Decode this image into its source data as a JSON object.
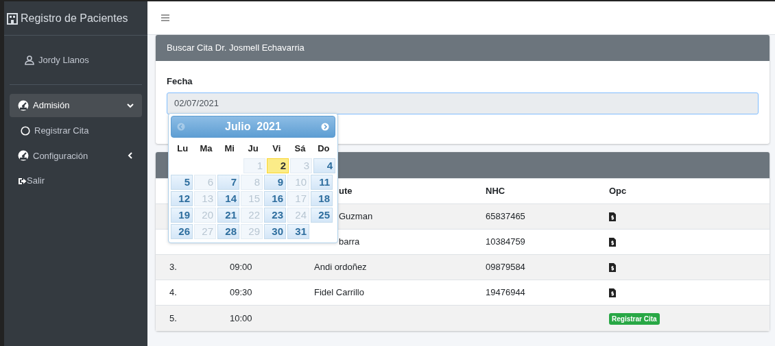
{
  "sidebar": {
    "brand": "Registro de Pacientes",
    "user": "Jordy Llanos",
    "menu": [
      {
        "kind": "group",
        "label": "Admisión",
        "selected": true,
        "expanded": true,
        "children": [
          {
            "label": "Registrar Cita",
            "selected": false
          }
        ]
      },
      {
        "kind": "group",
        "label": "Configuración",
        "selected": false,
        "expanded": false
      },
      {
        "kind": "link",
        "label": "Salir",
        "selected": false
      }
    ]
  },
  "search_card": {
    "title": "Buscar Cita Dr. Josmell Echavarria",
    "field_label": "Fecha",
    "value": "02/07/2021"
  },
  "datepicker": {
    "title": "Julio  2021",
    "prev_disabled": true,
    "weekdays": [
      "Lu",
      "Ma",
      "Mi",
      "Ju",
      "Vi",
      "Sá",
      "Do"
    ],
    "weeks": [
      {
        "days": [
          {
            "day": "1",
            "disabled": true,
            "selected": false
          },
          {
            "day": "2",
            "disabled": false,
            "selected": true
          },
          {
            "day": "3",
            "disabled": true,
            "selected": false
          },
          {
            "day": "4",
            "disabled": false,
            "selected": false
          }
        ]
      },
      {
        "days": [
          {
            "day": "5",
            "disabled": false,
            "selected": false
          },
          {
            "day": "6",
            "disabled": true,
            "selected": false
          },
          {
            "day": "7",
            "disabled": false,
            "selected": false
          },
          {
            "day": "8",
            "disabled": true,
            "selected": false
          },
          {
            "day": "9",
            "disabled": false,
            "selected": false
          },
          {
            "day": "10",
            "disabled": true,
            "selected": false
          },
          {
            "day": "11",
            "disabled": false,
            "selected": false
          }
        ]
      },
      {
        "days": [
          {
            "day": "12",
            "disabled": false,
            "selected": false
          },
          {
            "day": "13",
            "disabled": true,
            "selected": false
          },
          {
            "day": "14",
            "disabled": false,
            "selected": false
          },
          {
            "day": "15",
            "disabled": true,
            "selected": false
          },
          {
            "day": "16",
            "disabled": false,
            "selected": false
          },
          {
            "day": "17",
            "disabled": true,
            "selected": false
          },
          {
            "day": "18",
            "disabled": false,
            "selected": false
          }
        ]
      },
      {
        "days": [
          {
            "day": "19",
            "disabled": false,
            "selected": false
          },
          {
            "day": "20",
            "disabled": true,
            "selected": false
          },
          {
            "day": "21",
            "disabled": false,
            "selected": false
          },
          {
            "day": "22",
            "disabled": true,
            "selected": false
          },
          {
            "day": "23",
            "disabled": false,
            "selected": false
          },
          {
            "day": "24",
            "disabled": true,
            "selected": false
          },
          {
            "day": "25",
            "disabled": false,
            "selected": false
          }
        ]
      },
      {
        "days": [
          {
            "day": "26",
            "disabled": false,
            "selected": false
          },
          {
            "day": "27",
            "disabled": true,
            "selected": false
          },
          {
            "day": "28",
            "disabled": false,
            "selected": false
          },
          {
            "day": "29",
            "disabled": true,
            "selected": false
          },
          {
            "day": "30",
            "disabled": false,
            "selected": false
          },
          {
            "day": "31",
            "disabled": false,
            "selected": false
          }
        ]
      }
    ]
  },
  "table": {
    "columns": [
      {
        "label": "ute",
        "covered": true
      },
      {
        "label": "NHC",
        "covered": false
      },
      {
        "label": "Opc",
        "covered": false
      }
    ],
    "rows": [
      {
        "patient": "Guzman",
        "patient_covered": true,
        "nhc": "65837465",
        "action": {
          "kind": "icon"
        }
      },
      {
        "patient": "barra",
        "patient_covered": true,
        "nhc": "10384759",
        "action": {
          "kind": "icon"
        }
      },
      {
        "number": "3.",
        "time": "09:00",
        "patient": "Andi ordoñez",
        "patient_covered": false,
        "nhc": "09879584",
        "action": {
          "kind": "icon"
        }
      },
      {
        "number": "4.",
        "time": "09:30",
        "patient": "Fidel Carrillo",
        "patient_covered": false,
        "nhc": "19476944",
        "action": {
          "kind": "icon"
        }
      },
      {
        "number": "5.",
        "time": "10:00",
        "action": {
          "kind": "button",
          "label": "Registrar Cita"
        }
      }
    ]
  }
}
